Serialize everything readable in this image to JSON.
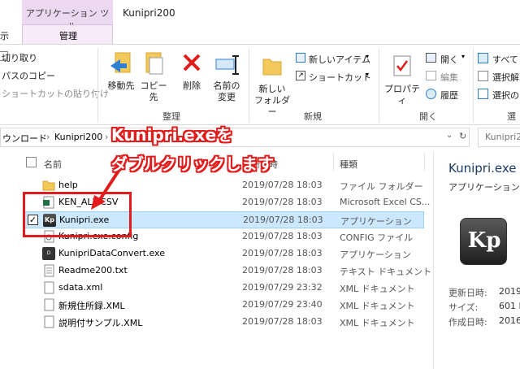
{
  "titlebar": {
    "context_tab": "アプリケーション ツール",
    "context_subtab": "管理",
    "title": "Kunipri200",
    "view_tab": "示"
  },
  "ribbon": {
    "clipboard": {
      "cut": "切り取り",
      "copy_path": "パスのコピー",
      "paste_shortcut": "ショートカットの貼り付け"
    },
    "organize": {
      "move_to": "移動先",
      "copy_to": "コピー先",
      "delete": "削除",
      "rename_line1": "名前の",
      "rename_line2": "変更",
      "group": "整理"
    },
    "new": {
      "new_folder_line1": "新しい",
      "new_folder_line2": "フォルダー",
      "new_item": "新しいアイテム",
      "shortcut": "ショートカット",
      "group": "新規"
    },
    "open": {
      "properties": "プロパティ",
      "open": "開く",
      "edit": "編集",
      "history": "履歴",
      "group": "開く"
    },
    "select": {
      "select_all": "すべて",
      "select_none": "選択解",
      "invert": "選択の",
      "group": "選"
    }
  },
  "address": {
    "path": [
      "ウンロード",
      "Kunipri200"
    ],
    "search_placeholder": "Kunipri2"
  },
  "columns": {
    "name": "名前",
    "date": "更新日時",
    "type": "種類"
  },
  "files": [
    {
      "name": "help",
      "date": "2019/07/28 18:03",
      "type": "ファイル フォルダー",
      "icon": "folder-icon"
    },
    {
      "name": "KEN_ALL.CSV",
      "date": "2019/07/28 18:03",
      "type": "Microsoft Excel CS...",
      "icon": "excel-icon"
    },
    {
      "name": "Kunipri.exe",
      "date": "2019/07/28 18:03",
      "type": "アプリケーション",
      "icon": "kp-app-icon",
      "selected": true
    },
    {
      "name": "Kunipri.exe.config",
      "date": "2019/07/28 18:03",
      "type": "CONFIG ファイル",
      "icon": "config-file-icon"
    },
    {
      "name": "KunipriDataConvert.exe",
      "date": "2019/07/28 18:03",
      "type": "アプリケーション",
      "icon": "data-app-icon"
    },
    {
      "name": "Readme200.txt",
      "date": "2019/07/28 18:03",
      "type": "テキスト ドキュメント",
      "icon": "text-file-icon"
    },
    {
      "name": "sdata.xml",
      "date": "2019/07/29 23:32",
      "type": "XML ドキュメント",
      "icon": "xml-file-icon"
    },
    {
      "name": "新規住所録.XML",
      "date": "2019/07/29 23:40",
      "type": "XML ドキュメント",
      "icon": "xml-file-icon"
    },
    {
      "name": "説明付サンプル.XML",
      "date": "2019/07/28 18:03",
      "type": "XML ドキュメント",
      "icon": "xml-file-icon"
    }
  ],
  "details": {
    "name": "Kunipri.exe",
    "type": "アプリケーション",
    "icon_text": "Kp",
    "modified_label": "更新日時:",
    "modified_value": "2019/",
    "size_label": "サイズ:",
    "size_value": "601 K",
    "created_label": "作成日時:",
    "created_value": "2016/"
  },
  "annotation": {
    "line1": "Kunipri.exeを",
    "line2": "ダブルクリックします",
    "color": "#e21b1b"
  }
}
